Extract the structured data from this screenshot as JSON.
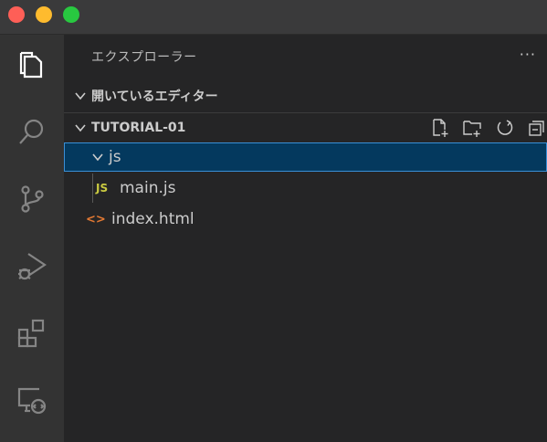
{
  "colors": {
    "close": "#fe5f57",
    "minimize": "#febb2e",
    "maximize": "#28c840",
    "selection_bg": "#04395e",
    "selection_border": "#3a8fd6",
    "js_icon": "#cbcb41",
    "html_icon": "#e37933"
  },
  "activity_bar": {
    "items": [
      "explorer-icon",
      "search-icon",
      "source-control-icon",
      "run-debug-icon",
      "extensions-icon",
      "remote-explorer-icon"
    ]
  },
  "sidebar": {
    "title": "エクスプローラー",
    "more": "···",
    "open_editors": {
      "label": "開いているエディター"
    },
    "workspace": {
      "label": "TUTORIAL-01",
      "toolbar": [
        "new-file-icon",
        "new-folder-icon",
        "refresh-icon",
        "collapse-all-icon"
      ]
    },
    "tree": {
      "folder": {
        "name": "js",
        "expanded": true,
        "selected": true
      },
      "file_main": {
        "name": "main.js",
        "icon_text": "JS"
      },
      "file_index": {
        "name": "index.html",
        "icon_text": "<>"
      }
    }
  }
}
